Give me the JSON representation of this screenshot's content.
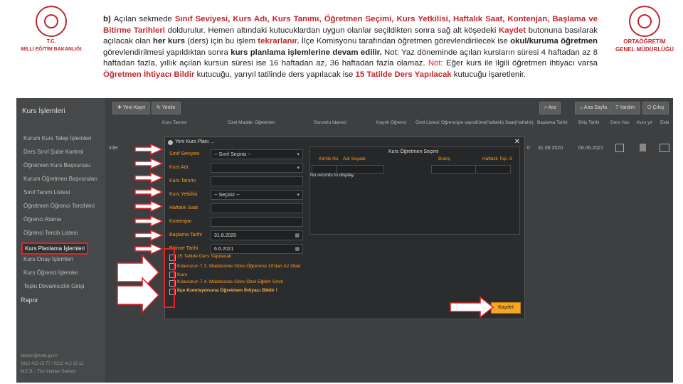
{
  "header": {
    "left_logo": {
      "line1": "T.C.",
      "line2": "MİLLİ EĞİTİM BAKANLIĞI"
    },
    "right_logo": {
      "line1": "ORTAÖĞRETİM",
      "line2": "GENEL MÜDÜRLÜĞÜ"
    },
    "description": [
      {
        "t": "b) ",
        "s": "bold"
      },
      {
        "t": "Açılan sekmede ",
        "s": ""
      },
      {
        "t": "Sınıf Seviyesi, Kurs Adı, Kurs Tanımı, Öğretmen Seçimi, Kurs Yetkilisi, Haftalık Saat, Kontenjan, Başlama ve Bitirme Tarihleri",
        "s": "red"
      },
      {
        "t": " doldurulur. Hemen altındaki kutucuklardan uygun olanlar seçildikten sonra sağ alt köşedeki ",
        "s": ""
      },
      {
        "t": "Kaydet",
        "s": "red"
      },
      {
        "t": " butonuna basılarak açılacak olan ",
        "s": ""
      },
      {
        "t": "her kurs",
        "s": "bold"
      },
      {
        "t": " (ders) için bu işlem ",
        "s": ""
      },
      {
        "t": "tekrarlanır.",
        "s": "red"
      },
      {
        "t": " İlçe Komisyonu tarafından öğretmen görevlendirilecek ise ",
        "s": ""
      },
      {
        "t": "okul/kuruma öğretmen",
        "s": "bold"
      },
      {
        "t": " görevlendirilmesi yapıldıktan sonra ",
        "s": ""
      },
      {
        "t": "kurs planlama işlemlerine devam edilir.",
        "s": "bold"
      },
      {
        "t": " Not: Yaz döneminde açılan kursların süresi 4 haftadan az 8 haftadan fazla, yıllık açılan kursun süresi ise 16 haftadan az, 36 haftadan fazla olamaz. ",
        "s": ""
      },
      {
        "t": "Not: ",
        "s": "red2"
      },
      {
        "t": "Eğer kurs ile ilgili öğretmen ihtiyacı varsa ",
        "s": ""
      },
      {
        "t": "Öğretmen İhtiyacı Bildir",
        "s": "red"
      },
      {
        "t": " kutucuğu, yarıyıl tatilinde ders yapılacak ise ",
        "s": ""
      },
      {
        "t": "15 Tatilde Ders Yapılacak",
        "s": "red"
      },
      {
        "t": " kutucuğu işaretlenir.",
        "s": ""
      }
    ]
  },
  "app": {
    "sidebar_title": "Kurs İşlemleri",
    "sidebar_items": [
      "Kurs İşlemleri",
      "Kurum Kurs Talep İşlemleri",
      "Ders Sınıf Şube Kontrol",
      "Öğretmen Kurs Başvurusu",
      "Kurum Öğretmen Başvuruları",
      "Sınıf Tanım Listesi",
      "Öğretmen Öğrenci Tercihleri",
      "Öğrenci Atama",
      "Öğrenci Tercih Listesi",
      "Kurs Planlama İşlemleri",
      "Kurs Onay İşlemleri",
      "Kurs Öğrenci İşlemler",
      "Toplu Devamsızlık Girişi",
      "Rapor"
    ],
    "sidebar_footer": [
      "iletisim@meb.gov.tr",
      "0312 413 15 77 / 0312 413 15 12",
      "M.E.B. - Tüm Hakları Saklıdır"
    ],
    "toolbar_left": [
      "Yeni Kayıt",
      "Yenile"
    ],
    "toolbar_right": [
      "Ara",
      "Ana Sayfa",
      "Yardım",
      "Çıkış"
    ],
    "columns": [
      "Kurs Tanımı",
      "Özel Madde",
      "Öğretmen",
      "Sorumlu İdareci",
      "Kayıtlı Öğrenci",
      "Özel Listesi",
      "Öğrenciyle sayısı",
      "Süre(Haftalık) Saat(Haftalık)",
      "Başlama Tarihi",
      "Bitiş Tarihi",
      "Ders Yarı",
      "Kurs yıl",
      "Ekle"
    ],
    "row": {
      "label": "inler",
      "num": "0",
      "start": "31.08.2020",
      "end": "06.06.2021"
    }
  },
  "dialog": {
    "title": "Yeni Kurs Planı ...",
    "fields": [
      {
        "label": "Sınıf Seviyesi",
        "value": "-- Sınıf Seçiniz --",
        "dropdown": true
      },
      {
        "label": "Kurs Adı",
        "value": "",
        "dropdown": true
      },
      {
        "label": "Kurs Tanımı",
        "value": "",
        "dropdown": false
      },
      {
        "label": "Kurs Yetkilisi",
        "value": "-- Seçiniz --",
        "dropdown": true
      },
      {
        "label": "Haftalık Saat",
        "value": "",
        "dropdown": false
      },
      {
        "label": "Kontenjan",
        "value": "",
        "dropdown": false
      },
      {
        "label": "Başlama Tarihi",
        "value": "31.8.2020",
        "dropdown": false
      },
      {
        "label": "Bitirme Tarihi",
        "value": "6.6.2021",
        "dropdown": false
      }
    ],
    "checkboxes": [
      "15 Tatilde Ders Yapılacak",
      "Kılavuzun 7.3. Maddesine Göre Öğrencisi 10'dan Az Olan Kurs",
      "Kılavuzun 7.4. Maddesine Göre Özel Eğitim Sınıfı",
      "İlçe Komisyonuna Öğretmen İhtiyacı Bildir !"
    ],
    "teacher_panel": {
      "title": "Kurs Öğretmen Seçimi",
      "headers": [
        "Kimlik No",
        "Adı Soyadı",
        "Branş",
        "Haftalık Top. S"
      ],
      "empty": "No records to display."
    },
    "save_button": "Kaydet"
  }
}
